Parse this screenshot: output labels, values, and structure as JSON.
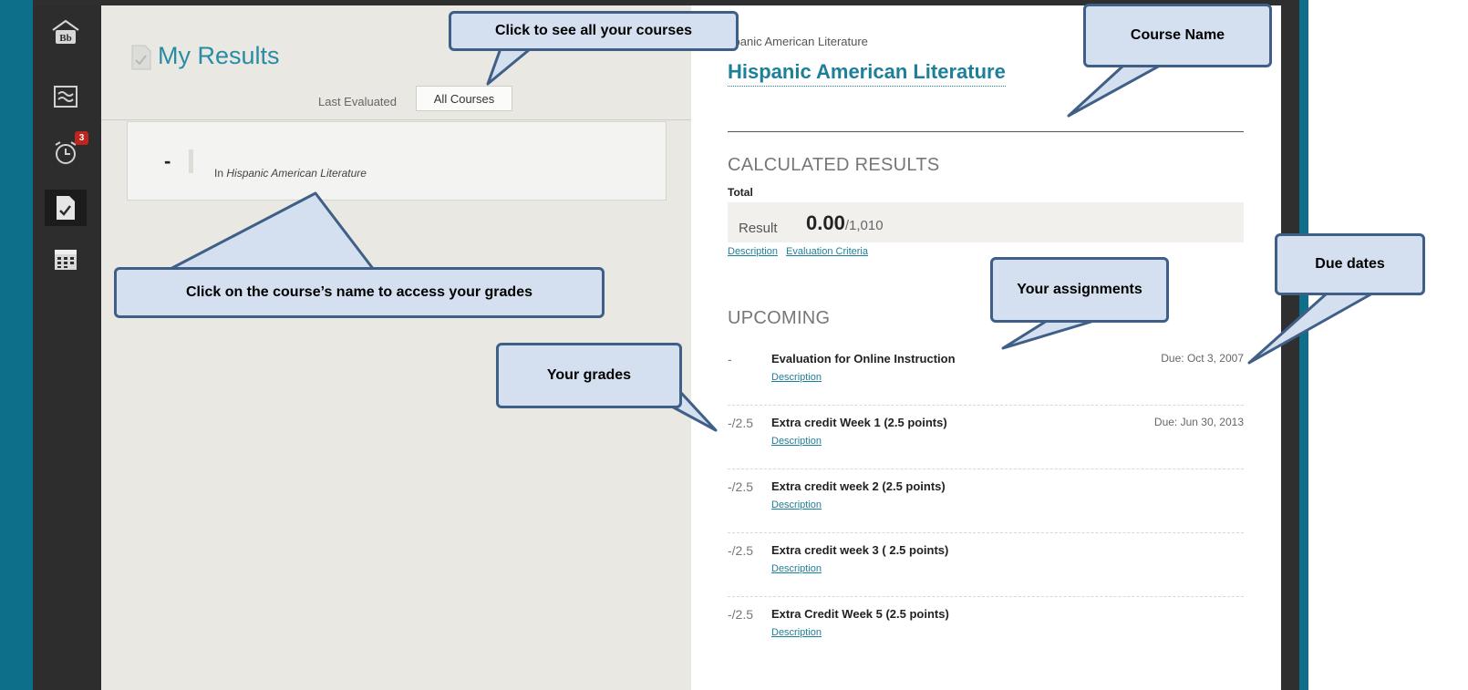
{
  "sidebar": {
    "items": [
      {
        "icon": "blackboard-home-icon",
        "label": "Bb"
      },
      {
        "icon": "stream-icon"
      },
      {
        "icon": "alarm-clock-icon",
        "badge": "3"
      },
      {
        "icon": "grades-icon",
        "active": true
      },
      {
        "icon": "calendar-icon"
      }
    ]
  },
  "left": {
    "title": "My Results",
    "last_evaluated": "Last Evaluated",
    "all_courses": "All Courses",
    "course_card": {
      "grade": "-",
      "in": "In",
      "course": "Hispanic American Literature"
    }
  },
  "right": {
    "breadcrumb": "spanic American Literature",
    "course_name": "Hispanic American Literature",
    "calc_heading": "CALCULATED RESULTS",
    "total_label": "Total",
    "result_word": "Result",
    "result_value": "0.00",
    "result_total": "/1,010",
    "link_description": "Description",
    "link_criteria": "Evaluation Criteria",
    "upcoming_heading": "UPCOMING",
    "upcoming": [
      {
        "grade": "-",
        "name": "Evaluation for Online Instruction",
        "desc": "Description",
        "due": "Due: Oct 3, 2007"
      },
      {
        "grade": "-/2.5",
        "name": "Extra credit Week 1 (2.5 points)",
        "desc": "Description",
        "due": "Due: Jun 30, 2013"
      },
      {
        "grade": "-/2.5",
        "name": "Extra credit week 2 (2.5 points)",
        "desc": "Description",
        "due": ""
      },
      {
        "grade": "-/2.5",
        "name": "Extra credit week 3 ( 2.5 points)",
        "desc": "Description",
        "due": ""
      },
      {
        "grade": "-/2.5",
        "name": "Extra Credit Week 5 (2.5 points)",
        "desc": "Description",
        "due": ""
      }
    ]
  },
  "callouts": {
    "all_courses": "Click to see all your courses",
    "course_name": "Course Name",
    "click_course": "Click on the course’s name to access your grades",
    "assignments": "Your assignments",
    "due_dates": "Due dates",
    "grades": "Your grades"
  },
  "colors": {
    "teal": "#0e6f8a",
    "link": "#1d7f99",
    "callout_fill": "#d4dff0",
    "callout_border": "#3f5f86"
  }
}
